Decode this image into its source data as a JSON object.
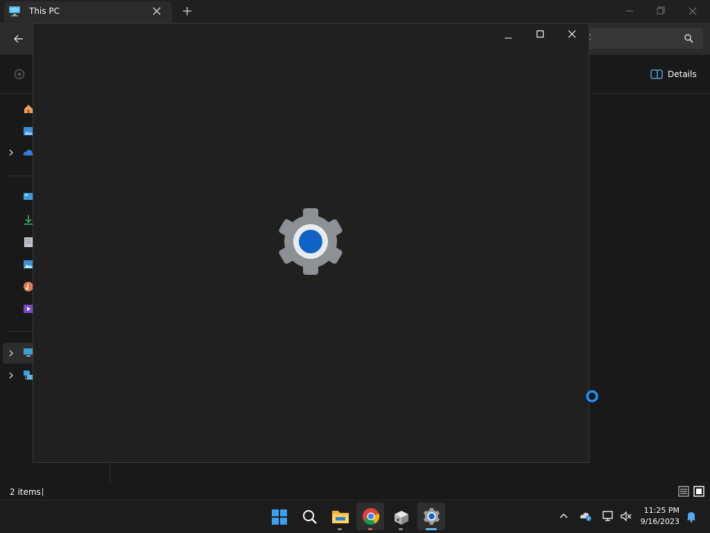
{
  "explorer": {
    "tab_title": "This PC",
    "search_placeholder_fragment": "c",
    "details_label": "Details",
    "status_items": "2 items"
  },
  "taskbar": {
    "clock_time": "11:25 PM",
    "clock_date": "9/16/2023"
  },
  "icons": {
    "tab": "monitor-icon",
    "settings": "gear-icon",
    "busy": "busy-ring-icon"
  },
  "colors": {
    "accent": "#0f63c4",
    "explorer_bg": "#191919",
    "window_bg": "#202020",
    "taskbar_bg": "#1c1c1c"
  }
}
